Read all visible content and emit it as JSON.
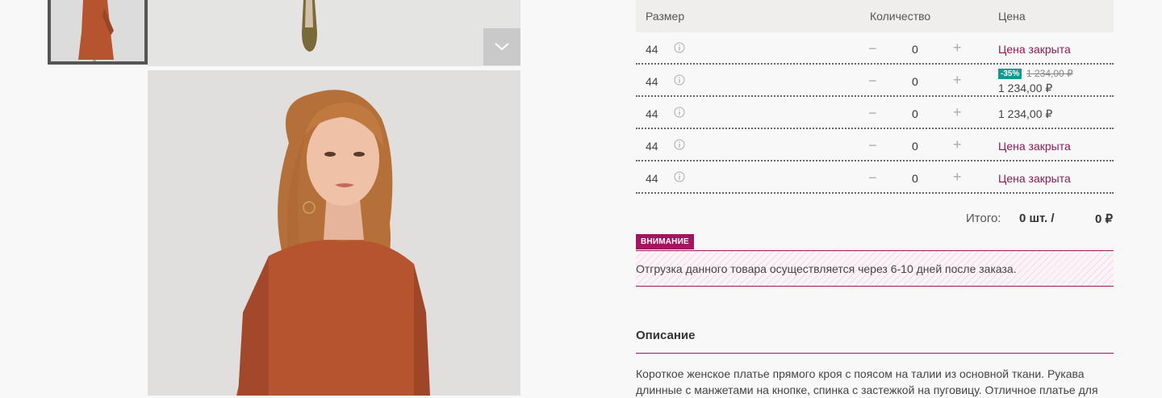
{
  "table": {
    "headers": {
      "size": "Размер",
      "quantity": "Количество",
      "price": "Цена"
    },
    "rows": [
      {
        "size": "44",
        "quantity": "0",
        "price_closed": "Цена закрыта"
      },
      {
        "size": "44",
        "quantity": "0",
        "discount": "-35%",
        "old_price": "1 234,00 ₽",
        "price": "1 234,00 ₽"
      },
      {
        "size": "44",
        "quantity": "0",
        "price": "1 234,00 ₽"
      },
      {
        "size": "44",
        "quantity": "0",
        "price_closed": "Цена закрыта"
      },
      {
        "size": "44",
        "quantity": "0",
        "price_closed": "Цена закрыта"
      }
    ],
    "controls": {
      "minus": "−",
      "plus": "+"
    }
  },
  "total": {
    "label": "Итого:",
    "count": "0 шт. /",
    "sum": "0 ₽"
  },
  "notice": {
    "badge": "ВНИМАНИЕ",
    "text": "Отгрузка данного товара осуществляется через 6-10 дней после заказа."
  },
  "description": {
    "title": "Описание",
    "text": "Короткое женское платье прямого кроя с поясом на талии из основной ткани. Рукава длинные с манжетами на кнопке, спинка с застежкой на пуговицу. Отличное платье для"
  },
  "colors": {
    "accent": "#a31560",
    "closed_price": "#8e1a58",
    "discount_badge": "#0f9b8e",
    "dress": "#b5542f"
  },
  "icons": {
    "info": "info-circle-icon",
    "gallery_scroll": "chevron-down-icon"
  }
}
